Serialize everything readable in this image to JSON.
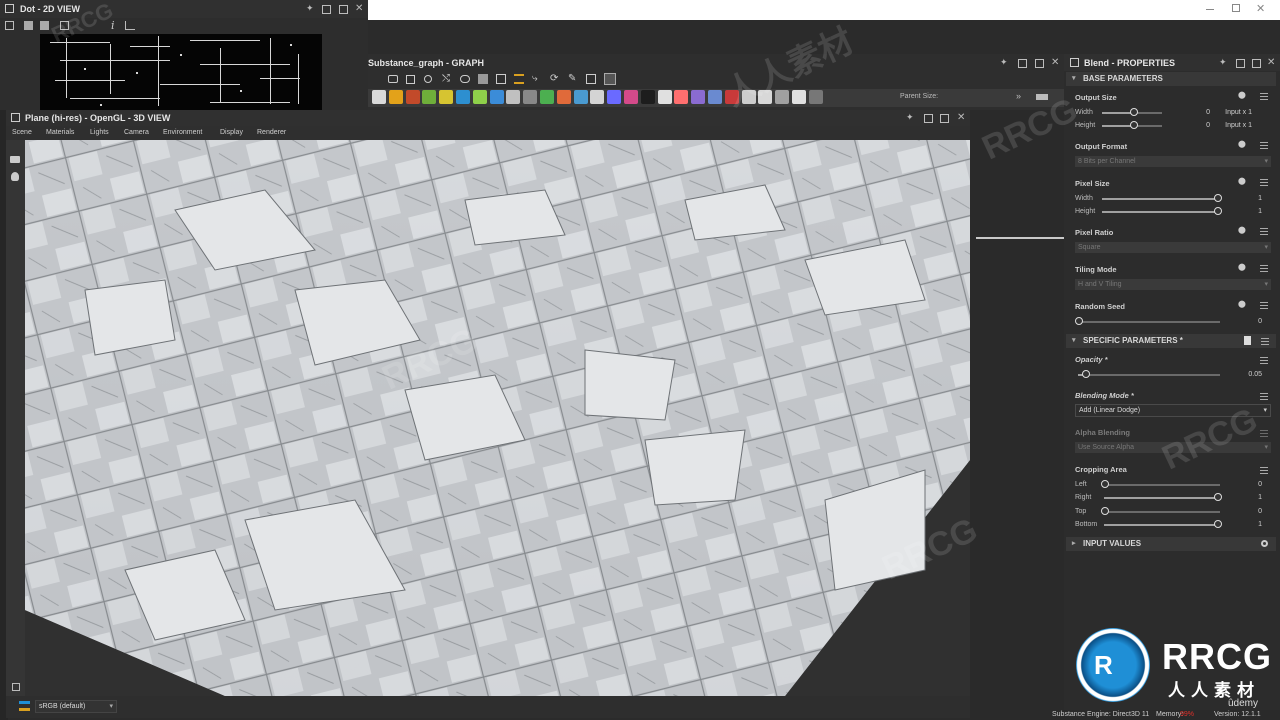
{
  "dot_view": {
    "title": "Dot - 2D VIEW",
    "info_icon_char": "i"
  },
  "graph": {
    "title": "Substance_graph - GRAPH",
    "parent_size_label": "Parent Size:",
    "more": "»"
  },
  "view3d": {
    "title": "Plane (hi-res) - OpenGL - 3D VIEW",
    "menu": [
      "Scene",
      "Materials",
      "Lights",
      "Camera",
      "Environment",
      "Display",
      "Renderer"
    ],
    "colorspace": "sRGB (default)"
  },
  "properties": {
    "title": "Blend - PROPERTIES",
    "base_header": "BASE PARAMETERS",
    "output_size": {
      "label": "Output Size",
      "width_label": "Width",
      "height_label": "Height",
      "width_value": "0",
      "height_value": "0",
      "width_mode": "Input x 1",
      "height_mode": "Input x 1"
    },
    "output_format": {
      "label": "Output Format",
      "value": "8 Bits per Channel"
    },
    "pixel_size": {
      "label": "Pixel Size",
      "width_label": "Width",
      "height_label": "Height",
      "width_value": "1",
      "height_value": "1"
    },
    "pixel_ratio": {
      "label": "Pixel Ratio",
      "value": "Square"
    },
    "tiling_mode": {
      "label": "Tiling Mode",
      "value": "H and V Tiling"
    },
    "random_seed": {
      "label": "Random Seed",
      "value": "0"
    },
    "specific_header": "SPECIFIC PARAMETERS *",
    "opacity": {
      "label": "Opacity *",
      "value": "0.05",
      "level": 0.05
    },
    "blending_mode": {
      "label": "Blending Mode *",
      "value": "Add (Linear Dodge)"
    },
    "alpha_blending": {
      "label": "Alpha Blending",
      "value": "Use Source Alpha"
    },
    "cropping": {
      "label": "Cropping Area",
      "left_label": "Left",
      "left_value": "0",
      "right_label": "Right",
      "right_value": "1",
      "top_label": "Top",
      "top_value": "0",
      "bottom_label": "Bottom",
      "bottom_value": "1"
    },
    "input_header": "INPUT VALUES"
  },
  "status": {
    "engine": "Substance Engine: Direct3D 11",
    "memory_label": "Memory:",
    "memory_value": "99%",
    "version": "Version: 12.1.1",
    "memory_color": "#e0302a"
  },
  "branding": {
    "logo_text": "RRCG",
    "logo_sub": "人人素材",
    "udemy": "ûdemy"
  },
  "colors": {
    "accent_blue": "#1f8fd6",
    "panel_bg": "#2b2b2b",
    "viewport_bg": "#3a3a3a"
  }
}
